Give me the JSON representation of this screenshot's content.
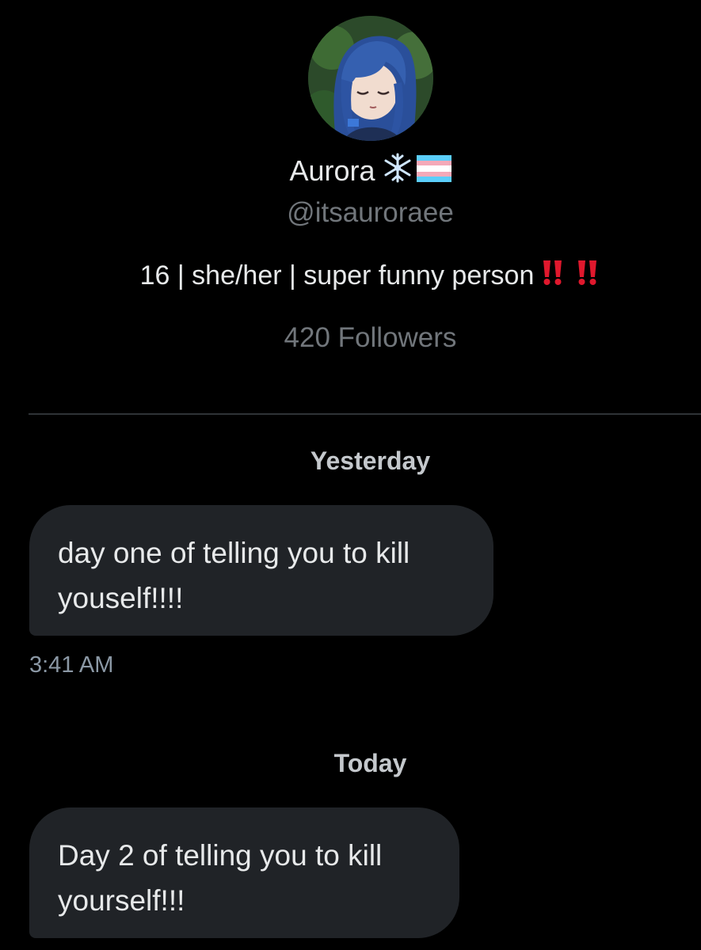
{
  "profile": {
    "display_name": "Aurora",
    "name_emoji_1": "snowflake-icon",
    "name_emoji_2": "trans-flag-icon",
    "handle": "@itsauroraee",
    "bio": "16 | she/her | super funny person",
    "bio_emoji": "double-exclamation-icon",
    "followers": "420 Followers"
  },
  "conversation": {
    "separator_1": "Yesterday",
    "message_1": {
      "line_1": "day one of telling you to kill",
      "line_2": "youself!!!!",
      "time": "3:41 AM"
    },
    "separator_2": "Today",
    "message_2": {
      "line_1": "Day 2 of telling you to kill",
      "line_2": "yourself!!!"
    }
  },
  "colors": {
    "background": "#000000",
    "bubble": "#202327",
    "primary_text": "#e7e9ea",
    "secondary_text": "#71767b",
    "divider": "#2f3336",
    "exclamation_red": "#e0182d"
  }
}
